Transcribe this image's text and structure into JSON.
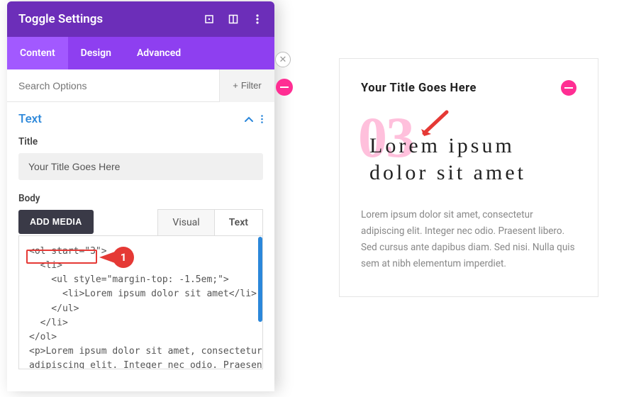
{
  "header": {
    "title": "Toggle Settings"
  },
  "tabs": {
    "content": "Content",
    "design": "Design",
    "advanced": "Advanced"
  },
  "search": {
    "placeholder": "Search Options",
    "filter_label": "Filter"
  },
  "section": {
    "title": "Text"
  },
  "fields": {
    "title_label": "Title",
    "title_value": "Your Title Goes Here",
    "body_label": "Body",
    "add_media": "ADD MEDIA"
  },
  "editor_tabs": {
    "visual": "Visual",
    "text": "Text"
  },
  "code": "<ol start=\"3\">\n  <li>\n    <ul style=\"margin-top: -1.5em;\">\n      <li>Lorem ipsum dolor sit amet</li>\n    </ul>\n  </li>\n</ol>\n<p>Lorem ipsum dolor sit amet, consectetur\nadipiscing elit. Integer nec odio. Praesent\nlibero. Sed cursus ante dapibus diam. Sed",
  "callout": {
    "num": "1"
  },
  "preview": {
    "title": "Your Title Goes Here",
    "big_number": "03",
    "heading": "Lorem ipsum dolor sit amet",
    "paragraph": "Lorem ipsum dolor sit amet, consectetur adipiscing elit. Integer nec odio. Praesent libero. Sed cursus ante dapibus diam. Sed nisi. Nulla quis sem at nibh elementum imperdiet."
  }
}
